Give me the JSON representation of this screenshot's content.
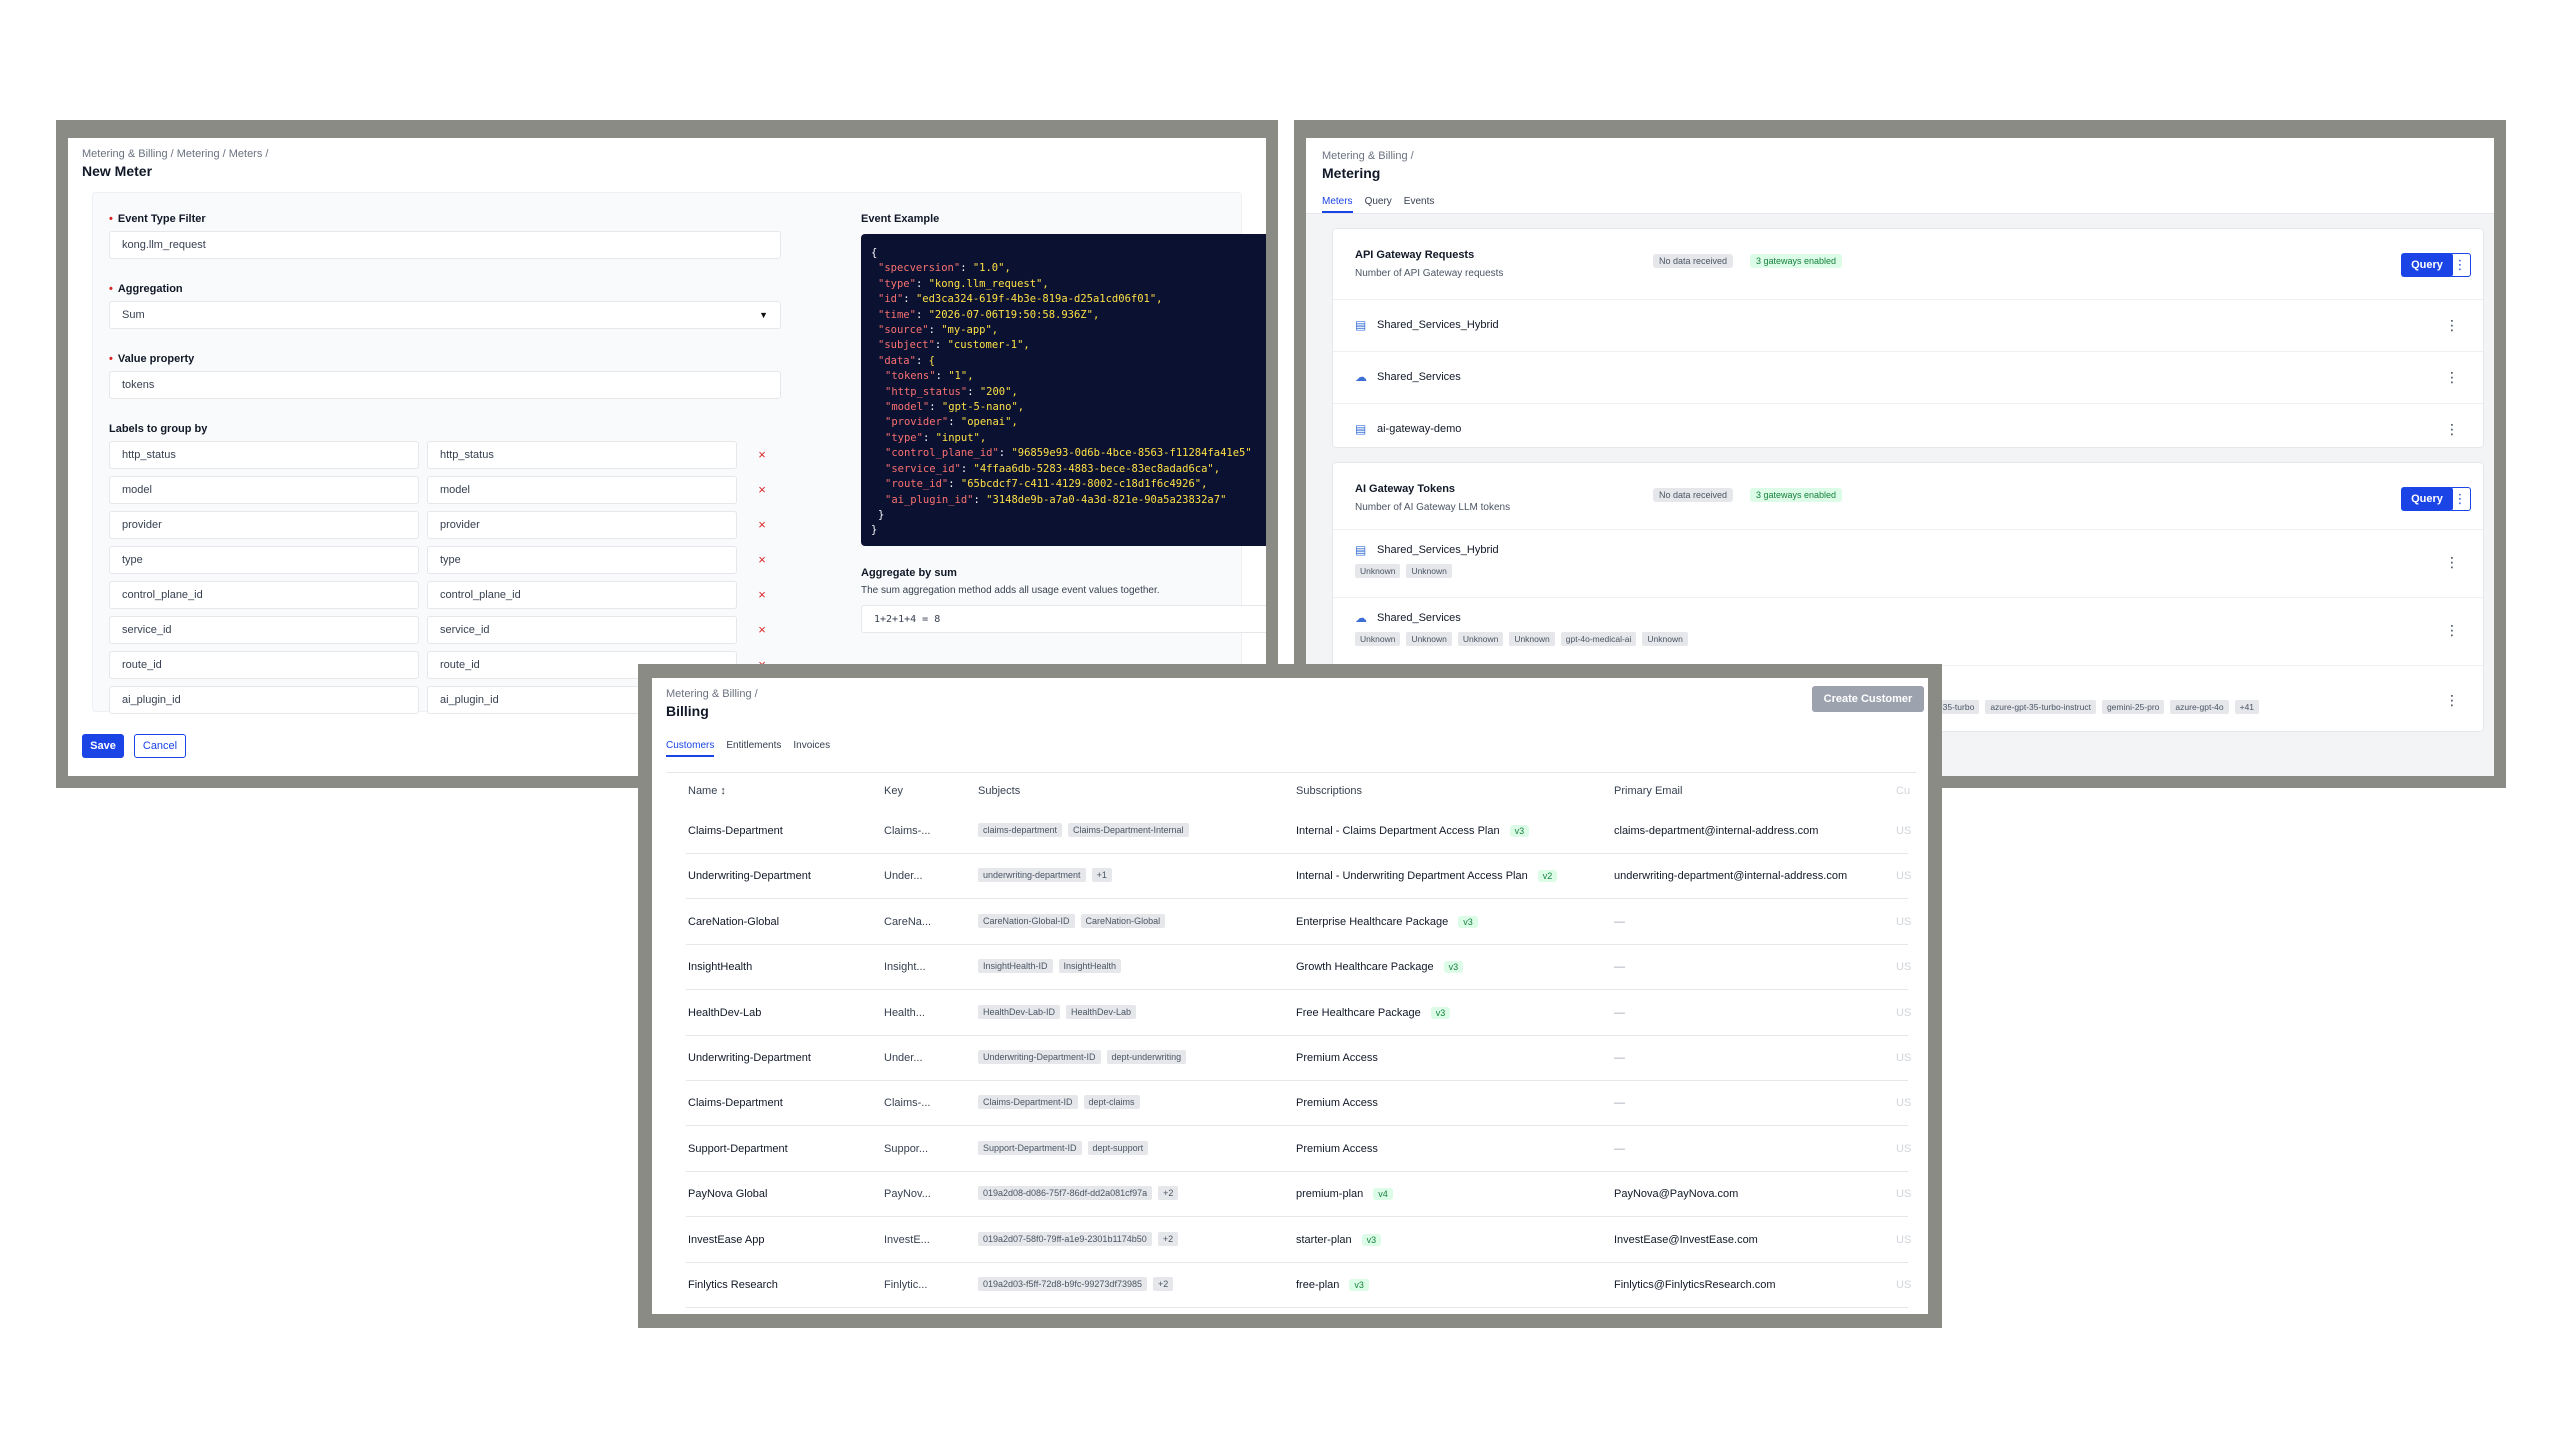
{
  "new_meter": {
    "breadcrumb": "Metering & Billing /  Metering /  Meters /",
    "title": "New Meter",
    "event_type_filter_label": "Event Type Filter",
    "event_type_filter_value": "kong.llm_request",
    "aggregation_label": "Aggregation",
    "aggregation_value": "Sum",
    "value_property_label": "Value property",
    "value_property_value": "tokens",
    "labels_group_label": "Labels to group by",
    "label_rows": [
      {
        "key": "http_status",
        "value": "http_status"
      },
      {
        "key": "model",
        "value": "model"
      },
      {
        "key": "provider",
        "value": "provider"
      },
      {
        "key": "type",
        "value": "type"
      },
      {
        "key": "control_plane_id",
        "value": "control_plane_id"
      },
      {
        "key": "service_id",
        "value": "service_id"
      },
      {
        "key": "route_id",
        "value": "route_id"
      },
      {
        "key": "ai_plugin_id",
        "value": "ai_plugin_id"
      }
    ],
    "delete_glyph": "×",
    "event_example_label": "Event Example",
    "event_example_lines": [
      {
        "indent": 0,
        "text": "{"
      },
      {
        "indent": 1,
        "key": "\"specversion\"",
        "val": "\"1.0\","
      },
      {
        "indent": 1,
        "key": "\"type\"",
        "val": "\"kong.llm_request\","
      },
      {
        "indent": 1,
        "key": "\"id\"",
        "val": "\"ed3ca324-619f-4b3e-819a-d25a1cd06f01\","
      },
      {
        "indent": 1,
        "key": "\"time\"",
        "val": "\"2026-07-06T19:50:58.936Z\","
      },
      {
        "indent": 1,
        "key": "\"source\"",
        "val": "\"my-app\","
      },
      {
        "indent": 1,
        "key": "\"subject\"",
        "val": "\"customer-1\","
      },
      {
        "indent": 1,
        "key": "\"data\"",
        "val": "{"
      },
      {
        "indent": 2,
        "key": "\"tokens\"",
        "val": "\"1\","
      },
      {
        "indent": 2,
        "key": "\"http_status\"",
        "val": "\"200\","
      },
      {
        "indent": 2,
        "key": "\"model\"",
        "val": "\"gpt-5-nano\","
      },
      {
        "indent": 2,
        "key": "\"provider\"",
        "val": "\"openai\","
      },
      {
        "indent": 2,
        "key": "\"type\"",
        "val": "\"input\","
      },
      {
        "indent": 2,
        "key": "\"control_plane_id\"",
        "val": "\"96859e93-0d6b-4bce-8563-f11284fa41e5\""
      },
      {
        "indent": 2,
        "key": "\"service_id\"",
        "val": "\"4ffaa6db-5283-4883-bece-83ec8adad6ca\","
      },
      {
        "indent": 2,
        "key": "\"route_id\"",
        "val": "\"65bcdcf7-c411-4129-8002-c18d1f6c4926\","
      },
      {
        "indent": 2,
        "key": "\"ai_plugin_id\"",
        "val": "\"3148de9b-a7a0-4a3d-821e-90a5a23832a7\""
      },
      {
        "indent": 1,
        "text": "}"
      },
      {
        "indent": 0,
        "text": "}"
      }
    ],
    "aggregate_title": "Aggregate by sum",
    "aggregate_desc": "The sum aggregation method adds all usage event values together.",
    "aggregate_formula": "1+2+1+4 = 8",
    "save_label": "Save",
    "cancel_label": "Cancel"
  },
  "metering": {
    "breadcrumb": "Metering & Billing /",
    "title": "Metering",
    "tabs": [
      "Meters",
      "Query",
      "Events"
    ],
    "cards": [
      {
        "title": "API Gateway Requests",
        "subtitle": "Number of API Gateway requests",
        "status_badge": "No data received",
        "gateways_badge": "3 gateways enabled",
        "query_label": "Query",
        "gateways": [
          {
            "name": "Shared_Services_Hybrid",
            "icon": "server-icon",
            "tags": []
          },
          {
            "name": "Shared_Services",
            "icon": "cloud-icon",
            "tags": []
          },
          {
            "name": "ai-gateway-demo",
            "icon": "server-icon",
            "tags": []
          }
        ]
      },
      {
        "title": "AI Gateway Tokens",
        "subtitle": "Number of AI Gateway LLM tokens",
        "status_badge": "No data received",
        "gateways_badge": "3 gateways enabled",
        "query_label": "Query",
        "gateways": [
          {
            "name": "Shared_Services_Hybrid",
            "icon": "server-icon",
            "tags": [
              "Unknown",
              "Unknown"
            ]
          },
          {
            "name": "Shared_Services",
            "icon": "cloud-icon",
            "tags": [
              "Unknown",
              "Unknown",
              "Unknown",
              "Unknown",
              "gpt-4o-medical-ai",
              "Unknown"
            ]
          },
          {
            "name": "",
            "icon": "",
            "tags": [
              "gpt-35-turbo",
              "azure-gpt-35-turbo-instruct",
              "gemini-25-pro",
              "azure-gpt-4o",
              "+41"
            ]
          }
        ]
      }
    ]
  },
  "billing": {
    "breadcrumb": "Metering & Billing /",
    "title": "Billing",
    "tabs": [
      "Customers",
      "Entitlements",
      "Invoices"
    ],
    "create_customer_label": "Create Customer",
    "columns": [
      "Name ↕",
      "Key",
      "Subjects",
      "Subscriptions",
      "Primary Email",
      "Cu"
    ],
    "rows": [
      {
        "name": "Claims-Department",
        "key": "Claims-...",
        "subjects": [
          "claims-department",
          "Claims-Department-Internal"
        ],
        "subscription": "Internal - Claims Department Access Plan",
        "version": "v3",
        "email": "claims-department@internal-address.com",
        "cut": "US"
      },
      {
        "name": "Underwriting-Department",
        "key": "Under...",
        "subjects": [
          "underwriting-department",
          "+1"
        ],
        "subscription": "Internal - Underwriting Department Access Plan",
        "version": "v2",
        "email": "underwriting-department@internal-address.com",
        "cut": "US"
      },
      {
        "name": "CareNation-Global",
        "key": "CareNa...",
        "subjects": [
          "CareNation-Global-ID",
          "CareNation-Global"
        ],
        "subscription": "Enterprise Healthcare Package",
        "version": "v3",
        "email": "—",
        "cut": "US"
      },
      {
        "name": "InsightHealth",
        "key": "Insight...",
        "subjects": [
          "InsightHealth-ID",
          "InsightHealth"
        ],
        "subscription": "Growth Healthcare Package",
        "version": "v3",
        "email": "—",
        "cut": "US"
      },
      {
        "name": "HealthDev-Lab",
        "key": "Health...",
        "subjects": [
          "HealthDev-Lab-ID",
          "HealthDev-Lab"
        ],
        "subscription": "Free Healthcare Package",
        "version": "v3",
        "email": "—",
        "cut": "US"
      },
      {
        "name": "Underwriting-Department",
        "key": "Under...",
        "subjects": [
          "Underwriting-Department-ID",
          "dept-underwriting"
        ],
        "subscription": "Premium Access",
        "version": "",
        "email": "—",
        "cut": "US"
      },
      {
        "name": "Claims-Department",
        "key": "Claims-...",
        "subjects": [
          "Claims-Department-ID",
          "dept-claims"
        ],
        "subscription": "Premium Access",
        "version": "",
        "email": "—",
        "cut": "US"
      },
      {
        "name": "Support-Department",
        "key": "Suppor...",
        "subjects": [
          "Support-Department-ID",
          "dept-support"
        ],
        "subscription": "Premium Access",
        "version": "",
        "email": "—",
        "cut": "US"
      },
      {
        "name": "PayNova Global",
        "key": "PayNov...",
        "subjects": [
          "019a2d08-d086-75f7-86df-dd2a081cf97a",
          "+2"
        ],
        "subscription": "premium-plan",
        "version": "v4",
        "email": "PayNova@PayNova.com",
        "cut": "US"
      },
      {
        "name": "InvestEase App",
        "key": "InvestE...",
        "subjects": [
          "019a2d07-58f0-79ff-a1e9-2301b1174b50",
          "+2"
        ],
        "subscription": "starter-plan",
        "version": "v3",
        "email": "InvestEase@InvestEase.com",
        "cut": "US"
      },
      {
        "name": "Finlytics Research",
        "key": "Finlytic...",
        "subjects": [
          "019a2d03-f5ff-72d8-b9fc-99273df73985",
          "+2"
        ],
        "subscription": "free-plan",
        "version": "v3",
        "email": "Finlytics@FinlyticsResearch.com",
        "cut": "US"
      }
    ]
  },
  "colors": {
    "accent": "#1a44e6",
    "frame": "#8b8b86",
    "code_bg": "#0b1130",
    "required": "#dc2626"
  }
}
